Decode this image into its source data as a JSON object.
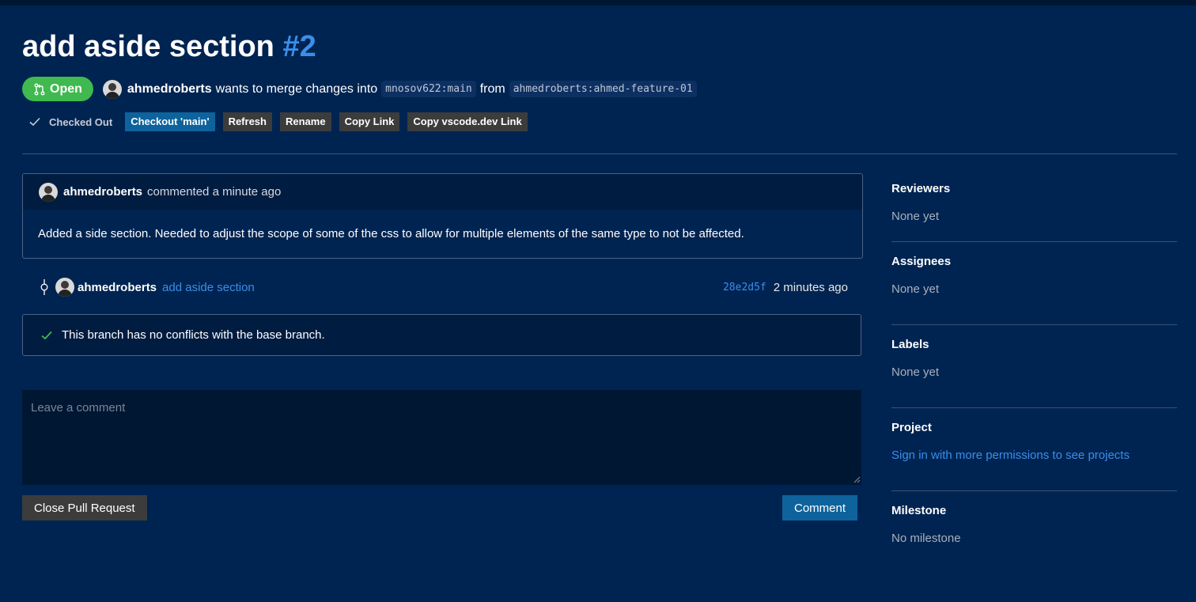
{
  "pr": {
    "title": "add aside section",
    "number": "#2",
    "status": "Open",
    "author": "ahmedroberts",
    "merge_text": "wants to merge changes into",
    "base_branch": "mnosov622:main",
    "from_text": "from",
    "head_branch": "ahmedroberts:ahmed-feature-01"
  },
  "actions": {
    "checked_out": "Checked Out",
    "checkout": "Checkout 'main'",
    "refresh": "Refresh",
    "rename": "Rename",
    "copy_link": "Copy Link",
    "copy_vscode": "Copy vscode.dev Link"
  },
  "comment": {
    "author": "ahmedroberts",
    "meta": "commented a minute ago",
    "body": "Added a side section. Needed to adjust the scope of some of the css to allow for multiple elements of the same type to not be affected."
  },
  "commit": {
    "author": "ahmedroberts",
    "message": "add aside section",
    "sha": "28e2d5f",
    "time": "2 minutes ago"
  },
  "merge_status": "This branch has no conflicts with the base branch.",
  "composer": {
    "placeholder": "Leave a comment",
    "close_label": "Close Pull Request",
    "comment_label": "Comment"
  },
  "sidebar": {
    "reviewers": {
      "title": "Reviewers",
      "value": "None yet"
    },
    "assignees": {
      "title": "Assignees",
      "value": "None yet"
    },
    "labels": {
      "title": "Labels",
      "value": "None yet"
    },
    "project": {
      "title": "Project",
      "value": "Sign in with more permissions to see projects"
    },
    "milestone": {
      "title": "Milestone",
      "value": "No milestone"
    }
  },
  "colors": {
    "background": "#002451",
    "accent": "#3b8eea",
    "open": "#3fb950",
    "primary_button": "#0e639c",
    "secondary_button": "#3c3c3c"
  }
}
